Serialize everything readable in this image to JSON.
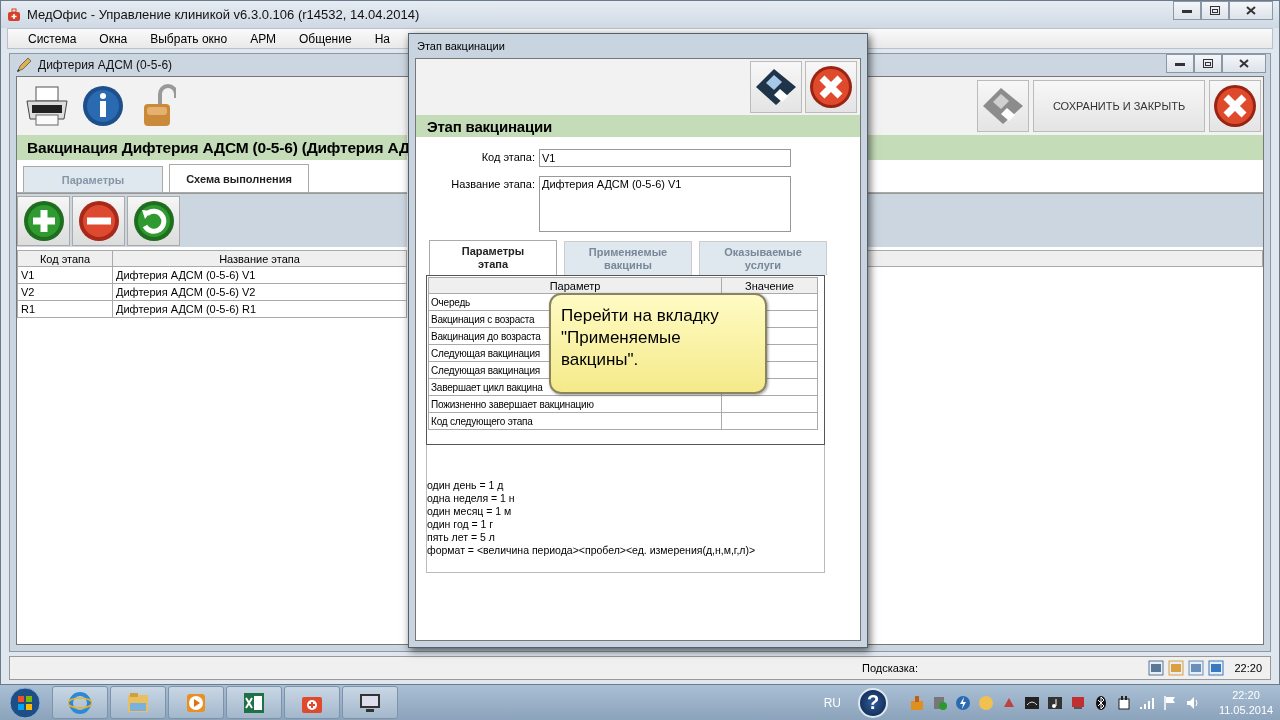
{
  "app": {
    "title": "МедОфис - Управление клиникой v6.3.0.106 (r14532, 14.04.2014)",
    "menu": [
      "Система",
      "Окна",
      "Выбрать окно",
      "АРМ",
      "Общение",
      "На"
    ]
  },
  "child_window": {
    "title": "Дифтерия АДСМ (0-5-6)",
    "heading": "Вакцинация Дифтерия АДСМ (0-5-6) (Дифтерия АД",
    "tabs": [
      {
        "label": "Параметры",
        "selected": false
      },
      {
        "label": "Схема выполнения",
        "selected": true
      }
    ],
    "table": {
      "columns": [
        "Код этапа",
        "Название этапа"
      ],
      "rows": [
        [
          "V1",
          "Дифтерия АДСМ (0-5-6) V1"
        ],
        [
          "V2",
          "Дифтерия АДСМ (0-5-6) V2"
        ],
        [
          "R1",
          "Дифтерия АДСМ (0-5-6) R1"
        ]
      ]
    },
    "save_and_close": "СОХРАНИТЬ И ЗАКРЫТЬ"
  },
  "dialog": {
    "title": "Этап вакцинации",
    "heading": "Этап вакцинации",
    "fields": [
      {
        "label": "Код этапа:",
        "value": "V1",
        "kind": "line"
      },
      {
        "label": "Название этапа:",
        "value": "Дифтерия АДСМ (0-5-6) V1",
        "kind": "area"
      }
    ],
    "tabs": [
      {
        "label": "Параметры этапа",
        "selected": true
      },
      {
        "label": "Применяемые вакцины",
        "selected": false
      },
      {
        "label": "Оказываемые услуги",
        "selected": false
      }
    ],
    "params_table": {
      "columns": [
        "Параметр",
        "Значение"
      ],
      "rows": [
        "Очередь",
        "Вакцинация с возраста",
        "Вакцинация до возраста",
        "Следующая вакцинация",
        "Следующая вакцинация",
        "Завершает цикл вакцина",
        "Пожизненно завершает вакцинацию",
        "Код следующего этапа"
      ]
    },
    "notes": [
      "один день = 1 д",
      "одна неделя = 1 н",
      "один месяц = 1 м",
      "один год = 1 г",
      "пять лет = 5 л",
      "формат = <величина периода><пробел><ед. измерения(д,н,м,г,л)>"
    ]
  },
  "callout": {
    "text": "Перейти на вкладку\n\"Применяемые\nвакцины\"."
  },
  "status_bar": {
    "hint_label": "Подсказка:",
    "time": "22:20"
  },
  "taskbar": {
    "language": "RU",
    "help": "?",
    "time": "22:20",
    "date": "11.05.2014"
  }
}
